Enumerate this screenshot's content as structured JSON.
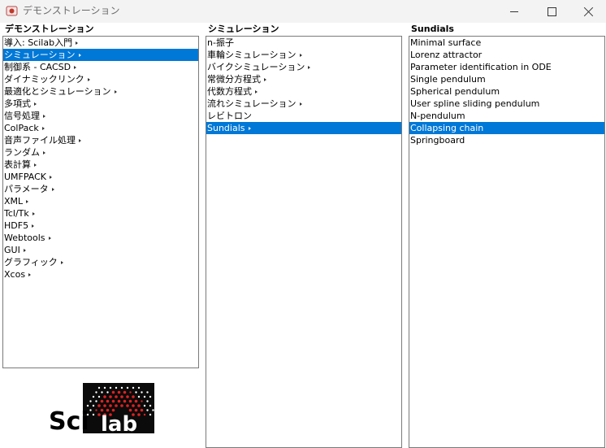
{
  "window": {
    "title": "デモンストレーション"
  },
  "columns": [
    {
      "header": "デモンストレーション",
      "items": [
        {
          "label": "導入: Scilab入門",
          "submenu": true
        },
        {
          "label": "シミュレーション",
          "submenu": true,
          "selected": true
        },
        {
          "label": "制御系 - CACSD",
          "submenu": true
        },
        {
          "label": "ダイナミックリンク",
          "submenu": true
        },
        {
          "label": "最適化とシミュレーション",
          "submenu": true
        },
        {
          "label": "多項式",
          "submenu": true
        },
        {
          "label": "信号処理",
          "submenu": true
        },
        {
          "label": "ColPack",
          "submenu": true
        },
        {
          "label": "音声ファイル処理",
          "submenu": true
        },
        {
          "label": "ランダム",
          "submenu": true
        },
        {
          "label": "表計算",
          "submenu": true
        },
        {
          "label": "UMFPACK",
          "submenu": true
        },
        {
          "label": "パラメータ",
          "submenu": true
        },
        {
          "label": "XML",
          "submenu": true
        },
        {
          "label": "Tcl/Tk",
          "submenu": true
        },
        {
          "label": "HDF5",
          "submenu": true
        },
        {
          "label": "Webtools",
          "submenu": true
        },
        {
          "label": "GUI",
          "submenu": true
        },
        {
          "label": "グラフィック",
          "submenu": true
        },
        {
          "label": "Xcos",
          "submenu": true
        }
      ]
    },
    {
      "header": "シミュレーション",
      "items": [
        {
          "label": "n-振子",
          "submenu": false
        },
        {
          "label": "車輪シミュレーション",
          "submenu": true
        },
        {
          "label": "バイクシミュレーション",
          "submenu": true
        },
        {
          "label": "常微分方程式",
          "submenu": true
        },
        {
          "label": "代数方程式",
          "submenu": true
        },
        {
          "label": "流れシミュレーション",
          "submenu": true
        },
        {
          "label": "レビトロン",
          "submenu": false
        },
        {
          "label": "Sundials",
          "submenu": true,
          "selected": true
        }
      ]
    },
    {
      "header": "Sundials",
      "items": [
        {
          "label": "Minimal surface",
          "submenu": false
        },
        {
          "label": "Lorenz attractor",
          "submenu": false
        },
        {
          "label": "Parameter identification in ODE",
          "submenu": false
        },
        {
          "label": "Single pendulum",
          "submenu": false
        },
        {
          "label": "Spherical pendulum",
          "submenu": false
        },
        {
          "label": "User spline sliding pendulum",
          "submenu": false
        },
        {
          "label": "N-pendulum",
          "submenu": false
        },
        {
          "label": "Collapsing chain",
          "submenu": false,
          "selected": true
        },
        {
          "label": "Springboard",
          "submenu": false
        }
      ]
    }
  ],
  "logo": {
    "text_sci": "Sci",
    "text_lab": "lab"
  },
  "colors": {
    "selection": "#0078d7",
    "logo_bg": "#0b0b0b",
    "logo_red": "#e02020"
  }
}
